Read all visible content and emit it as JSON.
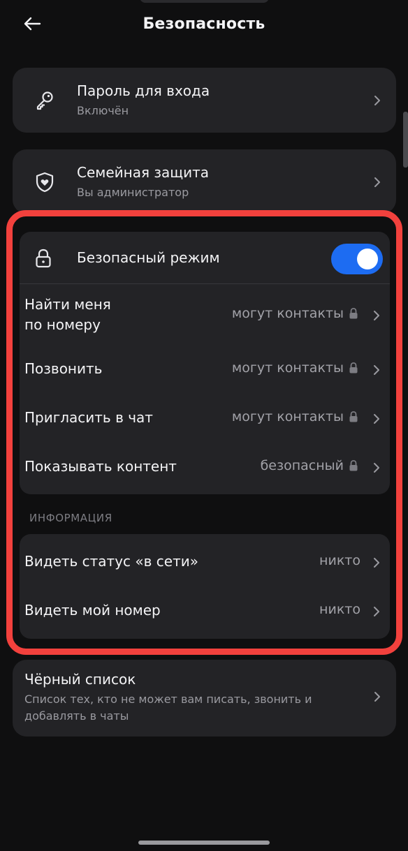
{
  "header": {
    "back_icon": "arrow-left-icon",
    "title": "Безопасность"
  },
  "login_password": {
    "icon": "key-icon",
    "title": "Пароль для входа",
    "subtitle": "Включён"
  },
  "family_protection": {
    "icon": "shield-heart-icon",
    "title": "Семейная защита",
    "subtitle": "Вы администратор"
  },
  "safe_mode": {
    "icon": "lock-icon",
    "title": "Безопасный режим",
    "enabled": true,
    "toggle_color": "#1d6cf2",
    "rows": [
      {
        "label": "Найти меня\nпо номеру",
        "value": "могут контакты",
        "locked": true
      },
      {
        "label": "Позвонить",
        "value": "могут контакты",
        "locked": true
      },
      {
        "label": "Пригласить в чат",
        "value": "могут контакты",
        "locked": true
      },
      {
        "label": "Показывать контент",
        "value": "безопасный",
        "locked": true
      }
    ]
  },
  "information": {
    "section_label": "ИНФОРМАЦИЯ",
    "rows": [
      {
        "label": "Видеть статус «в сети»",
        "value": "никто"
      },
      {
        "label": "Видеть мой номер",
        "value": "никто"
      }
    ]
  },
  "blacklist": {
    "title": "Чёрный список",
    "subtitle": "Список тех, кто не может вам писать, звонить и добавлять в чаты"
  },
  "highlight_color": "#f2413d"
}
